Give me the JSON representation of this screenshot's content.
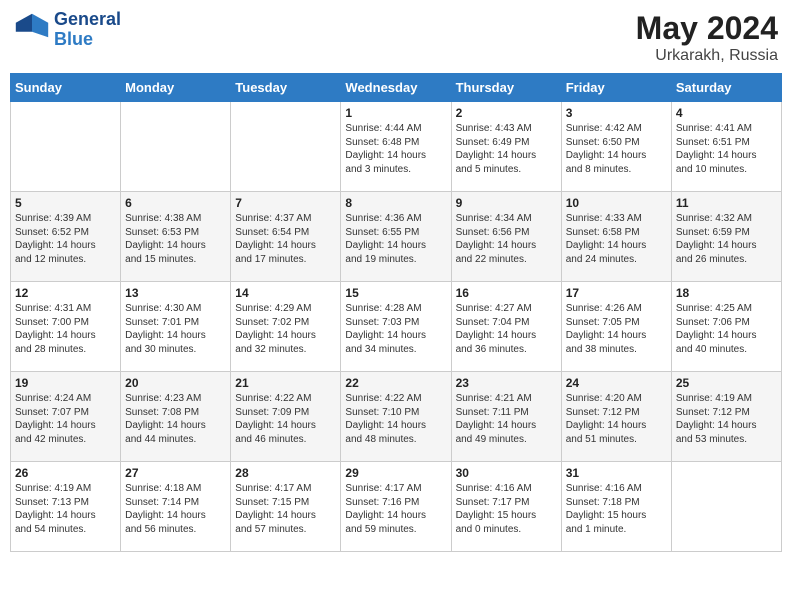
{
  "header": {
    "logo_line1": "General",
    "logo_line2": "Blue",
    "title": "May 2024",
    "location": "Urkarakh, Russia"
  },
  "days_of_week": [
    "Sunday",
    "Monday",
    "Tuesday",
    "Wednesday",
    "Thursday",
    "Friday",
    "Saturday"
  ],
  "weeks": [
    [
      {
        "day": "",
        "text": ""
      },
      {
        "day": "",
        "text": ""
      },
      {
        "day": "",
        "text": ""
      },
      {
        "day": "1",
        "text": "Sunrise: 4:44 AM\nSunset: 6:48 PM\nDaylight: 14 hours\nand 3 minutes."
      },
      {
        "day": "2",
        "text": "Sunrise: 4:43 AM\nSunset: 6:49 PM\nDaylight: 14 hours\nand 5 minutes."
      },
      {
        "day": "3",
        "text": "Sunrise: 4:42 AM\nSunset: 6:50 PM\nDaylight: 14 hours\nand 8 minutes."
      },
      {
        "day": "4",
        "text": "Sunrise: 4:41 AM\nSunset: 6:51 PM\nDaylight: 14 hours\nand 10 minutes."
      }
    ],
    [
      {
        "day": "5",
        "text": "Sunrise: 4:39 AM\nSunset: 6:52 PM\nDaylight: 14 hours\nand 12 minutes."
      },
      {
        "day": "6",
        "text": "Sunrise: 4:38 AM\nSunset: 6:53 PM\nDaylight: 14 hours\nand 15 minutes."
      },
      {
        "day": "7",
        "text": "Sunrise: 4:37 AM\nSunset: 6:54 PM\nDaylight: 14 hours\nand 17 minutes."
      },
      {
        "day": "8",
        "text": "Sunrise: 4:36 AM\nSunset: 6:55 PM\nDaylight: 14 hours\nand 19 minutes."
      },
      {
        "day": "9",
        "text": "Sunrise: 4:34 AM\nSunset: 6:56 PM\nDaylight: 14 hours\nand 22 minutes."
      },
      {
        "day": "10",
        "text": "Sunrise: 4:33 AM\nSunset: 6:58 PM\nDaylight: 14 hours\nand 24 minutes."
      },
      {
        "day": "11",
        "text": "Sunrise: 4:32 AM\nSunset: 6:59 PM\nDaylight: 14 hours\nand 26 minutes."
      }
    ],
    [
      {
        "day": "12",
        "text": "Sunrise: 4:31 AM\nSunset: 7:00 PM\nDaylight: 14 hours\nand 28 minutes."
      },
      {
        "day": "13",
        "text": "Sunrise: 4:30 AM\nSunset: 7:01 PM\nDaylight: 14 hours\nand 30 minutes."
      },
      {
        "day": "14",
        "text": "Sunrise: 4:29 AM\nSunset: 7:02 PM\nDaylight: 14 hours\nand 32 minutes."
      },
      {
        "day": "15",
        "text": "Sunrise: 4:28 AM\nSunset: 7:03 PM\nDaylight: 14 hours\nand 34 minutes."
      },
      {
        "day": "16",
        "text": "Sunrise: 4:27 AM\nSunset: 7:04 PM\nDaylight: 14 hours\nand 36 minutes."
      },
      {
        "day": "17",
        "text": "Sunrise: 4:26 AM\nSunset: 7:05 PM\nDaylight: 14 hours\nand 38 minutes."
      },
      {
        "day": "18",
        "text": "Sunrise: 4:25 AM\nSunset: 7:06 PM\nDaylight: 14 hours\nand 40 minutes."
      }
    ],
    [
      {
        "day": "19",
        "text": "Sunrise: 4:24 AM\nSunset: 7:07 PM\nDaylight: 14 hours\nand 42 minutes."
      },
      {
        "day": "20",
        "text": "Sunrise: 4:23 AM\nSunset: 7:08 PM\nDaylight: 14 hours\nand 44 minutes."
      },
      {
        "day": "21",
        "text": "Sunrise: 4:22 AM\nSunset: 7:09 PM\nDaylight: 14 hours\nand 46 minutes."
      },
      {
        "day": "22",
        "text": "Sunrise: 4:22 AM\nSunset: 7:10 PM\nDaylight: 14 hours\nand 48 minutes."
      },
      {
        "day": "23",
        "text": "Sunrise: 4:21 AM\nSunset: 7:11 PM\nDaylight: 14 hours\nand 49 minutes."
      },
      {
        "day": "24",
        "text": "Sunrise: 4:20 AM\nSunset: 7:12 PM\nDaylight: 14 hours\nand 51 minutes."
      },
      {
        "day": "25",
        "text": "Sunrise: 4:19 AM\nSunset: 7:12 PM\nDaylight: 14 hours\nand 53 minutes."
      }
    ],
    [
      {
        "day": "26",
        "text": "Sunrise: 4:19 AM\nSunset: 7:13 PM\nDaylight: 14 hours\nand 54 minutes."
      },
      {
        "day": "27",
        "text": "Sunrise: 4:18 AM\nSunset: 7:14 PM\nDaylight: 14 hours\nand 56 minutes."
      },
      {
        "day": "28",
        "text": "Sunrise: 4:17 AM\nSunset: 7:15 PM\nDaylight: 14 hours\nand 57 minutes."
      },
      {
        "day": "29",
        "text": "Sunrise: 4:17 AM\nSunset: 7:16 PM\nDaylight: 14 hours\nand 59 minutes."
      },
      {
        "day": "30",
        "text": "Sunrise: 4:16 AM\nSunset: 7:17 PM\nDaylight: 15 hours\nand 0 minutes."
      },
      {
        "day": "31",
        "text": "Sunrise: 4:16 AM\nSunset: 7:18 PM\nDaylight: 15 hours\nand 1 minute."
      },
      {
        "day": "",
        "text": ""
      }
    ]
  ]
}
